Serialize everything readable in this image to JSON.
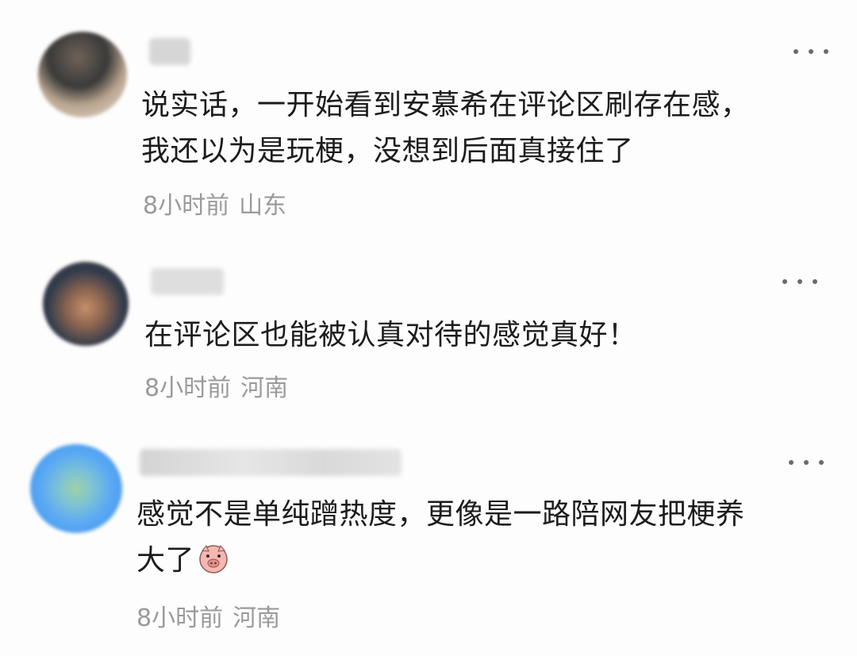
{
  "comments": [
    {
      "text_line1": "说实话，一开始看到安慕希在评论区刷存在感，",
      "text_line2": "我还以为是玩梗，没想到后面真接住了",
      "time": "8小时前",
      "location": "山东",
      "avatar_colors": [
        "#3a3a3a",
        "#b9a48e",
        "#e8e0d6"
      ]
    },
    {
      "text_line1": "在评论区也能被认真对待的感觉真好！",
      "time": "8小时前",
      "location": "河南",
      "avatar_colors": [
        "#2f3a4c",
        "#c68f6a",
        "#5a4638"
      ]
    },
    {
      "text_line1": "感觉不是单纯蹭热度，更像是一路陪网友把梗养",
      "text_line2": "大了",
      "emoji": "pig-face-emoji",
      "time": "8小时前",
      "location": "河南",
      "avatar_colors": [
        "#3e8fe6",
        "#9fd2a8",
        "#5aa9f5"
      ]
    }
  ],
  "icons": {
    "more": "more-dots-icon"
  }
}
